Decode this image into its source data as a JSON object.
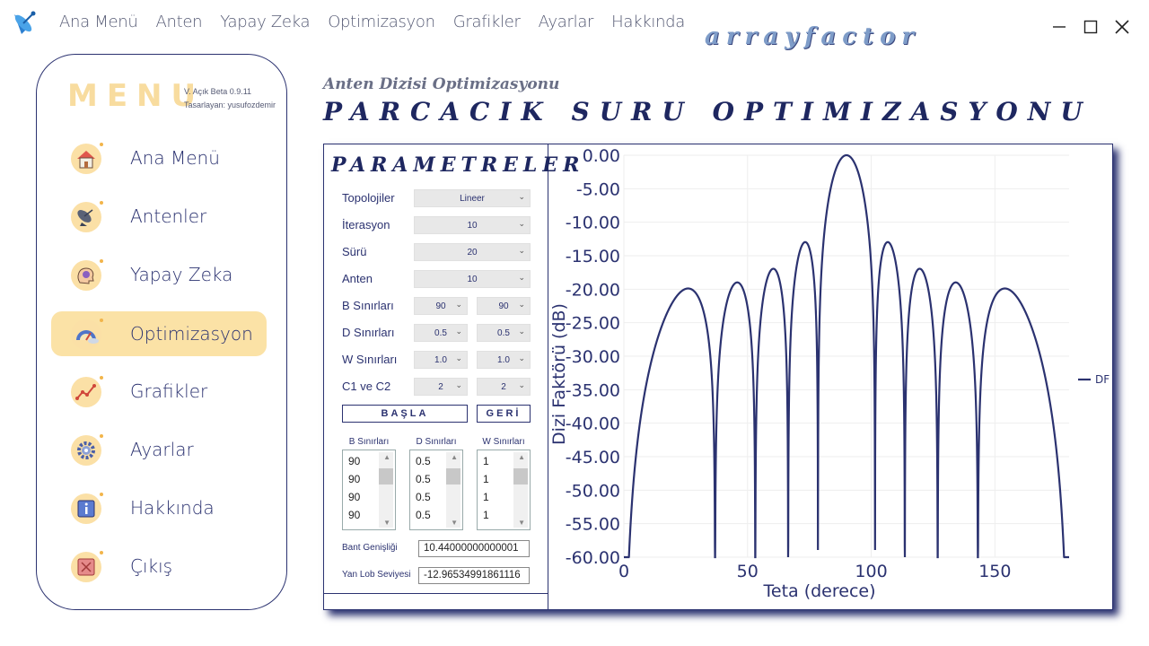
{
  "menubar": [
    "Ana Menü",
    "Anten",
    "Yapay Zeka",
    "Optimizasyon",
    "Grafikler",
    "Ayarlar",
    "Hakkında"
  ],
  "brand": "arrayfactor",
  "sidebar": {
    "title": "MENU",
    "version": "V. Açık Beta 0.9.11",
    "author": "Tasarlayan: yusufozdemir",
    "items": [
      {
        "label": "Ana Menü",
        "icon": "home-icon",
        "active": false
      },
      {
        "label": "Antenler",
        "icon": "satellite-dish-icon",
        "active": false
      },
      {
        "label": "Yapay Zeka",
        "icon": "brain-icon",
        "active": false
      },
      {
        "label": "Optimizasyon",
        "icon": "gauge-icon",
        "active": true
      },
      {
        "label": "Grafikler",
        "icon": "line-chart-icon",
        "active": false
      },
      {
        "label": "Ayarlar",
        "icon": "gear-icon",
        "active": false
      },
      {
        "label": "Hakkında",
        "icon": "info-icon",
        "active": false
      },
      {
        "label": "Çıkış",
        "icon": "exit-icon",
        "active": false
      }
    ]
  },
  "page": {
    "subtitle": "Anten Dizisi Optimizasyonu",
    "title": "PARCACIK SURU OPTIMIZASYONU"
  },
  "params": {
    "title": "PARAMETRELER",
    "topolojiler": {
      "label": "Topolojiler",
      "value": "Lineer"
    },
    "iterasyon": {
      "label": "İterasyon",
      "value": "10"
    },
    "suru": {
      "label": "Sürü",
      "value": "20"
    },
    "anten": {
      "label": "Anten",
      "value": "10"
    },
    "b_sinir": {
      "label": "B Sınırları",
      "min": "90",
      "max": "90"
    },
    "d_sinir": {
      "label": "D Sınırları",
      "min": "0.5",
      "max": "0.5"
    },
    "w_sinir": {
      "label": "W Sınırları",
      "min": "1.0",
      "max": "1.0"
    },
    "c1c2": {
      "label": "C1 ve C2",
      "min": "2",
      "max": "2"
    },
    "start_label": "BAŞLA",
    "back_label": "GERİ",
    "lists": {
      "b_header": "B Sınırları",
      "d_header": "D Sınırları",
      "w_header": "W Sınırları",
      "b_items": [
        "90",
        "90",
        "90",
        "90"
      ],
      "d_items": [
        "0.5",
        "0.5",
        "0.5",
        "0.5"
      ],
      "w_items": [
        "1",
        "1",
        "1",
        "1"
      ]
    },
    "bandwidth": {
      "label": "Bant Genişliği",
      "value": "10.44000000000001"
    },
    "sidelobe": {
      "label": "Yan Lob Seviyesi",
      "value": "-12.96534991861116"
    }
  },
  "chart_data": {
    "type": "line",
    "xlabel": "Teta (derece)",
    "ylabel": "Dizi Faktörü (dB)",
    "xlim": [
      0,
      180
    ],
    "ylim": [
      -60,
      0
    ],
    "xticks": [
      "0",
      "50",
      "100",
      "150"
    ],
    "yticks": [
      "0.00",
      "-5.00",
      "-10.00",
      "-15.00",
      "-20.00",
      "-25.00",
      "-30.00",
      "-35.00",
      "-40.00",
      "-45.00",
      "-50.00",
      "-55.00",
      "-60.00"
    ],
    "legend": "right",
    "series": [
      {
        "name": "DF",
        "color": "#2b3270",
        "function": "10-element uniform linear array, d=0.5λ, beta=90°, dB floor -60"
      }
    ]
  }
}
